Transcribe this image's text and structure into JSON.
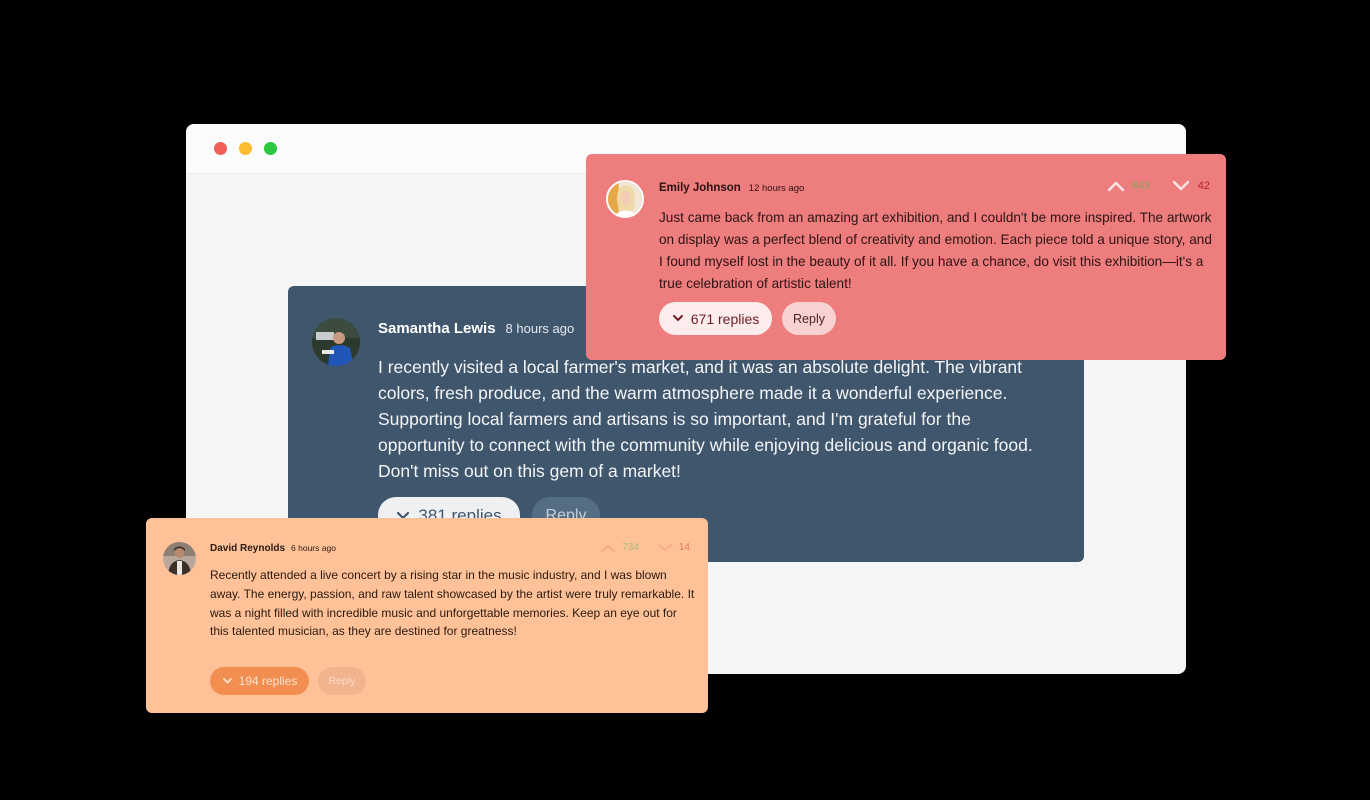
{
  "window": {
    "controls": [
      "close",
      "minimize",
      "maximize"
    ]
  },
  "comments": {
    "samantha": {
      "author": "Samantha Lewis",
      "time": "8 hours ago",
      "text": "I recently visited a local farmer's market, and it was an absolute delight. The vibrant colors, fresh produce, and the warm atmosphere made it a wonderful experience. Supporting local farmers and artisans is so important, and I'm grateful for the opportunity to connect with the community while enjoying delicious and organic food. Don't miss out on this gem of a market!",
      "replies_label": "381 replies",
      "reply_label": "Reply",
      "card_color": "#3f566c"
    },
    "emily": {
      "author": "Emily Johnson",
      "time": "12 hours ago",
      "upvotes": "843",
      "downvotes": "42",
      "text": "Just came back from an amazing art exhibition, and I couldn't be more inspired. The artwork on display was a perfect blend of creativity and emotion. Each piece told a unique story, and I found myself lost in the beauty of it all. If you have a chance, do visit this exhibition—it's a true celebration of artistic talent!",
      "replies_label": "671 replies",
      "reply_label": "Reply",
      "card_color": "#ee7d7e"
    },
    "david": {
      "author": "David Reynolds",
      "time": "6 hours ago",
      "upvotes": "734",
      "downvotes": "14",
      "text": "Recently attended a live concert by a rising star in the music industry, and I was blown away. The energy, passion, and raw talent showcased by the artist were truly remarkable. It was a night filled with incredible music and unforgettable memories. Keep an eye out for this talented musician, as they are destined for greatness!",
      "replies_label": "194 replies",
      "reply_label": "Reply",
      "card_color": "#ffc197"
    }
  },
  "icons": {
    "upvote": "chevron-up-icon",
    "downvote": "chevron-down-icon",
    "expand_replies": "chevron-down-icon"
  }
}
